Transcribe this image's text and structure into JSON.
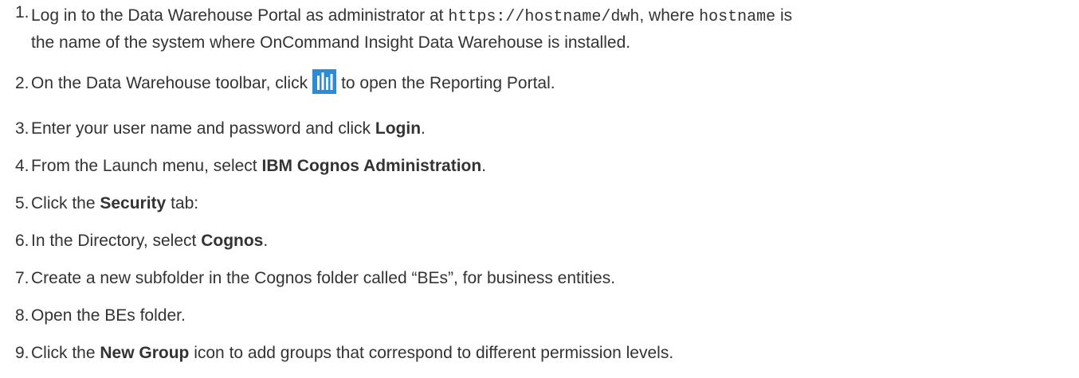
{
  "steps": [
    {
      "num": "1.",
      "t1": "Log in to the Data Warehouse Portal as administrator at ",
      "code1": "https://hostname/dwh",
      "t2": ", where ",
      "code2": "hostname",
      "t3": " is",
      "t4": "the name of the system where OnCommand Insight Data Warehouse is installed."
    },
    {
      "num": "2.",
      "t1": "On the Data Warehouse toolbar, click",
      "icon": "reporting-portal-icon",
      "t2": "to open the Reporting Portal."
    },
    {
      "num": "3.",
      "t1": "Enter your user name and password and click ",
      "bold": "Login",
      "t2": "."
    },
    {
      "num": "4.",
      "t1": "From the Launch menu, select ",
      "bold": "IBM Cognos Administration",
      "t2": "."
    },
    {
      "num": "5.",
      "t1": "Click the ",
      "bold": "Security",
      "t2": " tab:"
    },
    {
      "num": "6.",
      "t1": "In the Directory, select ",
      "bold": "Cognos",
      "t2": "."
    },
    {
      "num": "7.",
      "t1": "Create a new subfolder in the Cognos folder called “BEs”, for business entities."
    },
    {
      "num": "8.",
      "t1": "Open the BEs folder."
    },
    {
      "num": "9.",
      "t1": "Click the ",
      "bold": "New Group",
      "t2": " icon to add groups that correspond to different permission levels."
    }
  ],
  "colors": {
    "text": "#333333",
    "icon_bg": "#2a8bd6"
  }
}
